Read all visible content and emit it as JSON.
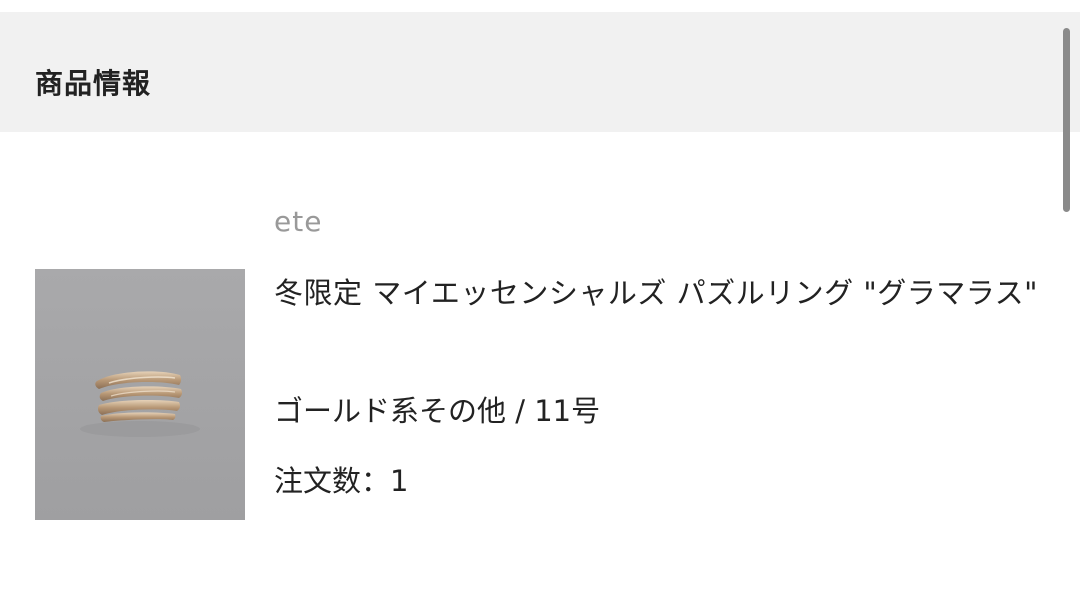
{
  "header": {
    "title": "商品情報"
  },
  "product": {
    "brand": "ete",
    "name": "冬限定 マイエッセンシャルズ パズルリング \"グラマラス\"",
    "variant": "ゴールド系その他 / 11号",
    "quantity_text": "注文数：1"
  }
}
